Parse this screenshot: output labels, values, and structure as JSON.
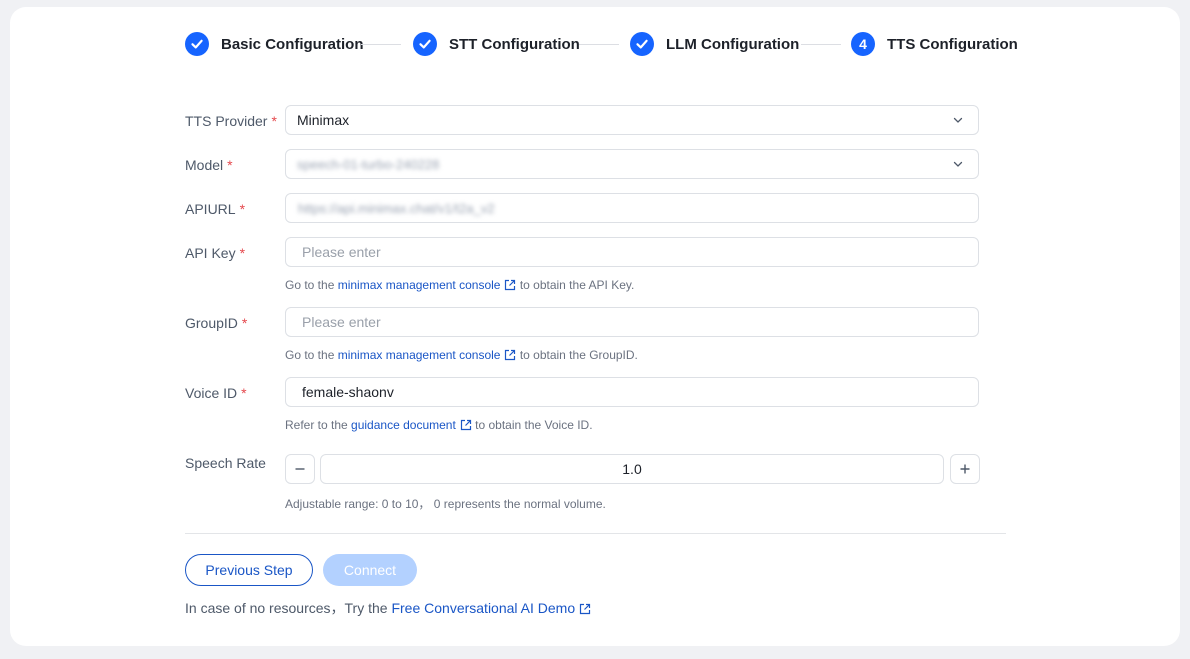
{
  "steps": [
    {
      "label": "Basic Configuration",
      "state": "done"
    },
    {
      "label": "STT Configuration",
      "state": "done"
    },
    {
      "label": "LLM Configuration",
      "state": "done"
    },
    {
      "label": "TTS Configuration",
      "state": "active",
      "number": "4"
    }
  ],
  "form": {
    "tts_provider": {
      "label": "TTS Provider",
      "value": "Minimax"
    },
    "model": {
      "label": "Model",
      "value": "speech-01-turbo-240228"
    },
    "apiurl": {
      "label": "APIURL",
      "value": "https://api.minimax.chat/v1/t2a_v2"
    },
    "api_key": {
      "label": "API Key",
      "placeholder": "Please enter",
      "hint_prefix": "Go to the",
      "hint_link": "minimax management console",
      "hint_suffix": "to obtain the API Key."
    },
    "group_id": {
      "label": "GroupID",
      "placeholder": "Please enter",
      "hint_prefix": "Go to the",
      "hint_link": "minimax management console",
      "hint_suffix": "to obtain the GroupID."
    },
    "voice_id": {
      "label": "Voice ID",
      "value": "female-shaonv",
      "hint_prefix": "Refer to the",
      "hint_link": "guidance document",
      "hint_suffix": "to obtain the Voice ID."
    },
    "speech_rate": {
      "label": "Speech Rate",
      "value": "1.0",
      "hint": "Adjustable range: 0 to 10，  0 represents the normal volume."
    },
    "required_mark": "*"
  },
  "buttons": {
    "previous": "Previous Step",
    "connect": "Connect"
  },
  "footer": {
    "prefix": "In case of no resources，Try the",
    "link": "Free Conversational AI Demo"
  },
  "colors": {
    "accent": "#1664ff",
    "link": "#1a56c6",
    "required": "#e5484d",
    "disabled_button": "#b3d1ff"
  }
}
